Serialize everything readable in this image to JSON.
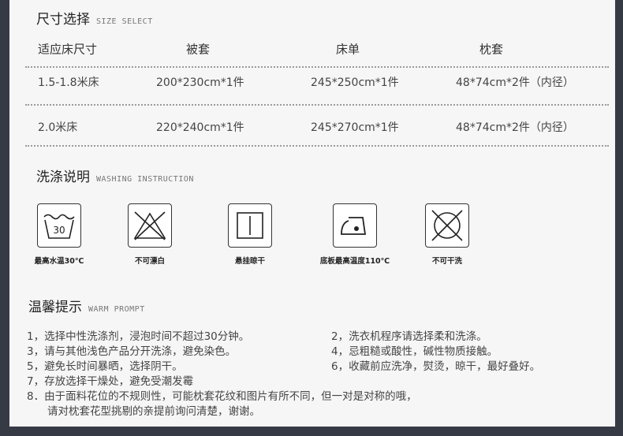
{
  "size_section": {
    "title_cn": "尺寸选择",
    "title_en": "SIZE SELECT"
  },
  "size_table": {
    "headers": [
      "适应床尺寸",
      "被套",
      "床单",
      "枕套"
    ],
    "rows": [
      [
        "1.5-1.8米床",
        "200*230cm*1件",
        "245*250cm*1件",
        "48*74cm*2件（内径）"
      ],
      [
        "2.0米床",
        "220*240cm*1件",
        "245*270cm*1件",
        "48*74cm*2件（内径）"
      ]
    ]
  },
  "wash_section": {
    "title_cn": "洗涤说明",
    "title_en": "WASHING INSTRUCTION"
  },
  "wash_icons": [
    {
      "icon": "wash-30-icon",
      "tub_text": "30",
      "label": "最高水温30℃"
    },
    {
      "icon": "no-bleach-icon",
      "label": "不可漂白"
    },
    {
      "icon": "hang-dry-icon",
      "label": "悬挂晾干"
    },
    {
      "icon": "iron-medium-icon",
      "label": "底板最高温度110℃"
    },
    {
      "icon": "no-dry-clean-icon",
      "label": "不可干洗"
    }
  ],
  "prompt_section": {
    "title_cn": "温馨提示",
    "title_en": "WARM PROMPT"
  },
  "tips": {
    "left": [
      "1，选择中性洗涤剂，浸泡时间不超过30分钟。",
      "3，请与其他浅色产品分开洗涤，避免染色。",
      "5，避免长时间暴晒，选择阴干。",
      "7，存放选择干燥处，避免受潮发霉"
    ],
    "right": [
      "2，洗衣机程序请选择柔和洗涤。",
      "4，忌粗糙或酸性，碱性物质接触。",
      "6，收藏前应洗净，熨烫，晾干，最好叠好。"
    ],
    "note_line1": "8．由于面料花位的不规则性，可能枕套花纹和图片有所不同，但一对是对称的哦，",
    "note_line2": "请对枕套花型挑剔的亲提前询问清楚，谢谢。"
  },
  "colors": {
    "frame": "#363a45",
    "sheet": "#f6f6f6",
    "text": "#333333"
  }
}
